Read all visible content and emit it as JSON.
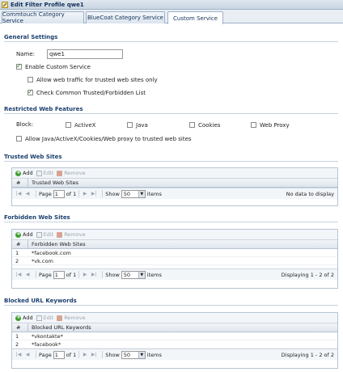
{
  "window": {
    "title": "Edit Filter Profile qwe1"
  },
  "tabs": [
    {
      "label": "Commtouch Category Service"
    },
    {
      "label": "BlueCoat Category Service"
    },
    {
      "label": "Custom Service"
    }
  ],
  "general": {
    "title": "General Settings",
    "name_label": "Name:",
    "name_value": "qwe1",
    "enable_custom_service": "Enable Custom Service",
    "allow_trusted": "Allow web traffic for trusted web sites only",
    "check_common": "Check Common Trusted/Forbidden List"
  },
  "restricted": {
    "title": "Restricted Web Features",
    "block_label": "Block:",
    "activex": "ActiveX",
    "java": "Java",
    "cookies": "Cookies",
    "web_proxy": "Web Proxy",
    "allow_java": "Allow Java/ActiveX/Cookies/Web proxy to trusted web sites"
  },
  "toolbar": {
    "add": "Add",
    "edit": "Edit",
    "remove": "Remove"
  },
  "pager": {
    "page": "Page",
    "of1": "of 1",
    "show": "Show",
    "items": "items",
    "page_value": "1",
    "show_value": "50"
  },
  "trusted": {
    "title": "Trusted Web Sites",
    "col_num": "#",
    "col_name": "Trusted Web Sites",
    "status": "No data to display"
  },
  "forbidden": {
    "title": "Forbidden Web Sites",
    "col_num": "#",
    "col_name": "Forbidden Web Sites",
    "rows": [
      {
        "num": "1",
        "value": "*facebook.com"
      },
      {
        "num": "2",
        "value": "*vk.com"
      }
    ],
    "status": "Displaying 1 - 2 of 2"
  },
  "keywords": {
    "title": "Blocked URL Keywords",
    "col_num": "#",
    "col_name": "Blocked URL Keywords",
    "rows": [
      {
        "num": "1",
        "value": "*vkontakte*"
      },
      {
        "num": "2",
        "value": "*facebook*"
      }
    ],
    "status": "Displaying 1 - 2 of 2"
  }
}
